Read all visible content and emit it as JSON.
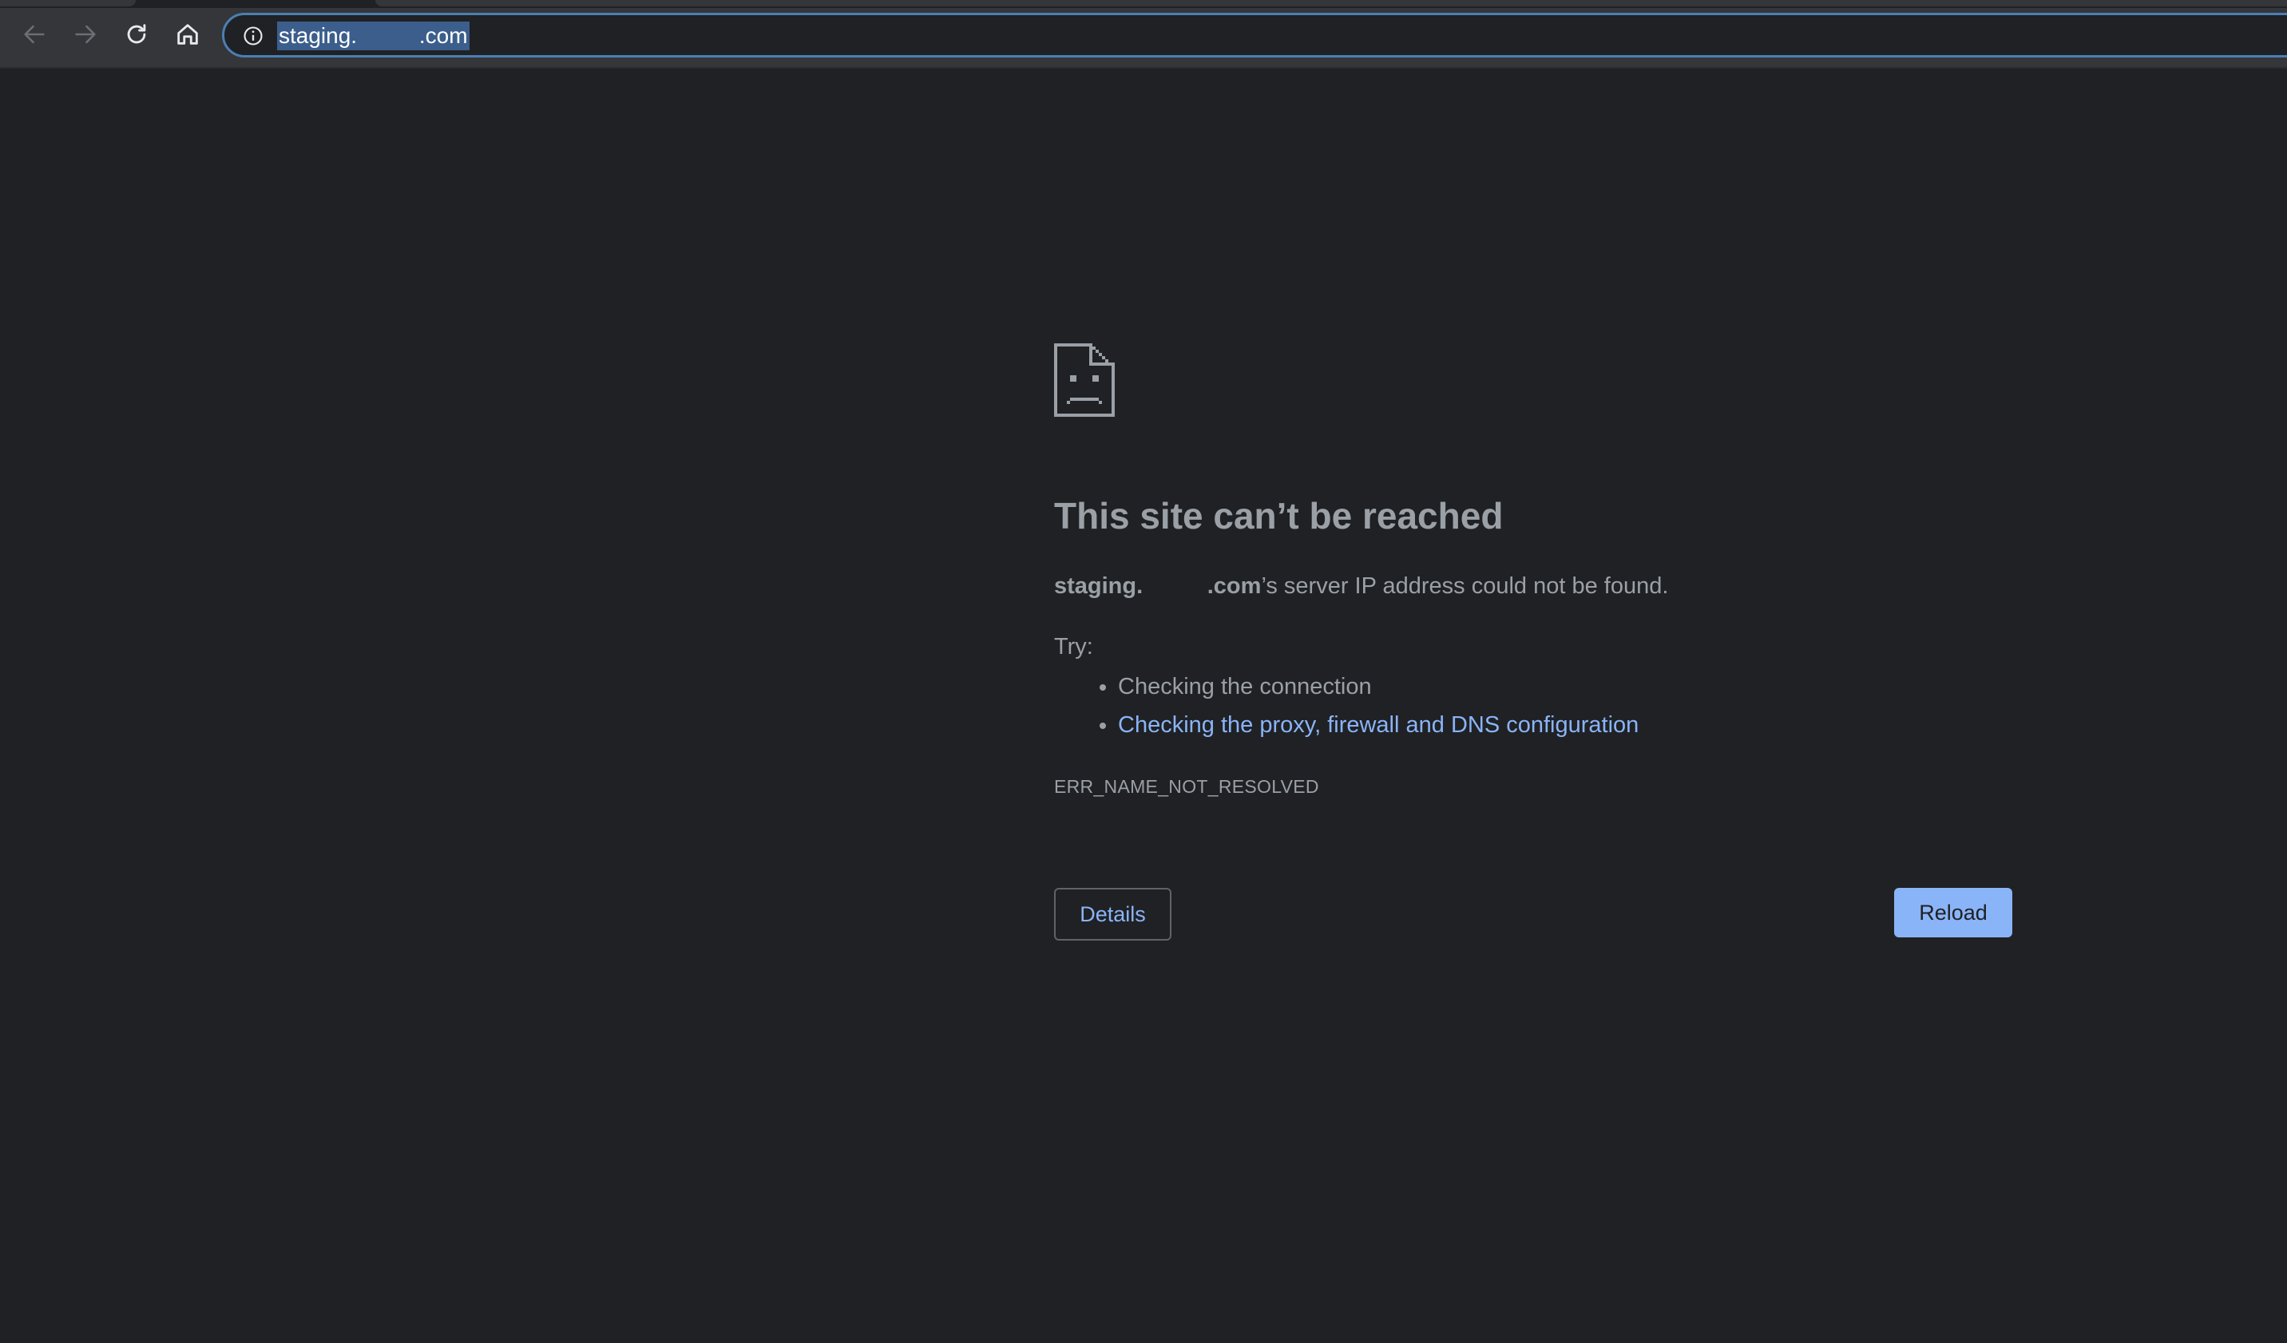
{
  "browser": {
    "address_bar": {
      "url": "staging.          .com",
      "icon": "info-icon"
    },
    "nav": {
      "back_icon": "arrow-back-icon",
      "forward_icon": "arrow-forward-icon",
      "reload_icon": "reload-icon",
      "home_icon": "home-icon"
    }
  },
  "error_page": {
    "icon": "sad-page-icon",
    "title": "This site can’t be reached",
    "summary_host": "staging.          .com",
    "summary_rest": "’s server IP address could not be found.",
    "try_label": "Try:",
    "suggestions": [
      "Checking the connection",
      "Checking the proxy, firewall and DNS configuration"
    ],
    "error_code": "ERR_NAME_NOT_RESOLVED",
    "details_label": "Details",
    "reload_label": "Reload"
  },
  "colors": {
    "background": "#202124",
    "toolbar": "#35363a",
    "text": "#9aa0a6",
    "link": "#8ab4f8",
    "button_primary": "#8ab4f8",
    "url_selection": "#3b5e8c"
  }
}
